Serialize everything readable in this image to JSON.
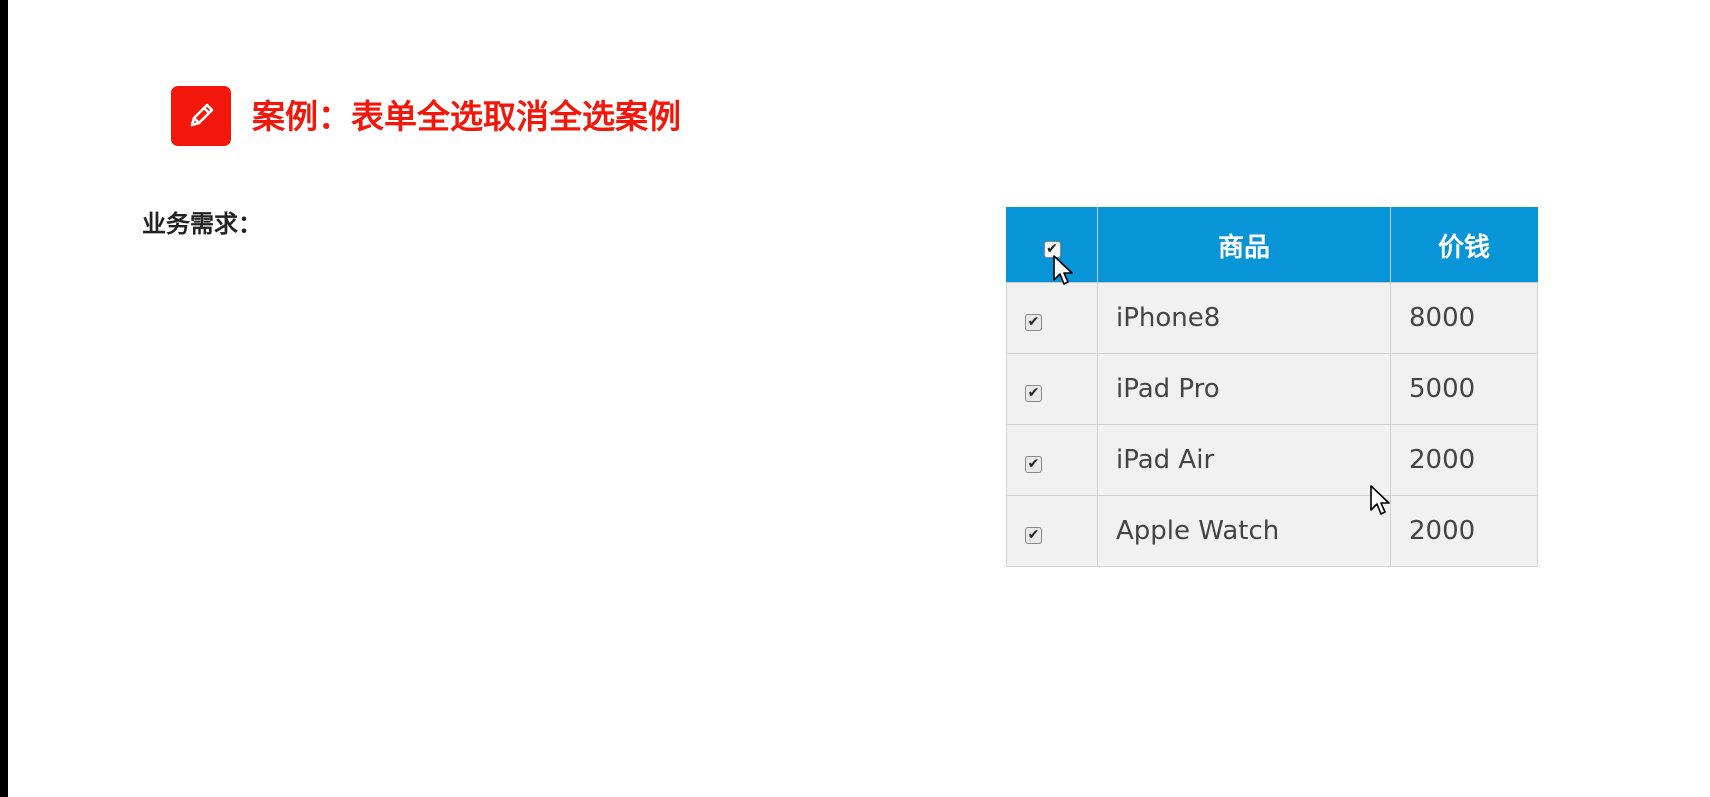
{
  "title": "案例：表单全选取消全选案例",
  "title_icon": "pencil-icon",
  "requirement_label": "业务需求：",
  "colors": {
    "title_red": "#f2170a",
    "header_blue": "#0795d7",
    "row_bg": "#f1f1f1"
  },
  "table": {
    "select_all_checked": true,
    "headers": {
      "product": "商品",
      "price": "价钱"
    },
    "rows": [
      {
        "checked": true,
        "product": "iPhone8",
        "price": "8000"
      },
      {
        "checked": true,
        "product": "iPad Pro",
        "price": "5000"
      },
      {
        "checked": true,
        "product": "iPad Air",
        "price": "2000"
      },
      {
        "checked": true,
        "product": "Apple Watch",
        "price": "2000"
      }
    ]
  }
}
